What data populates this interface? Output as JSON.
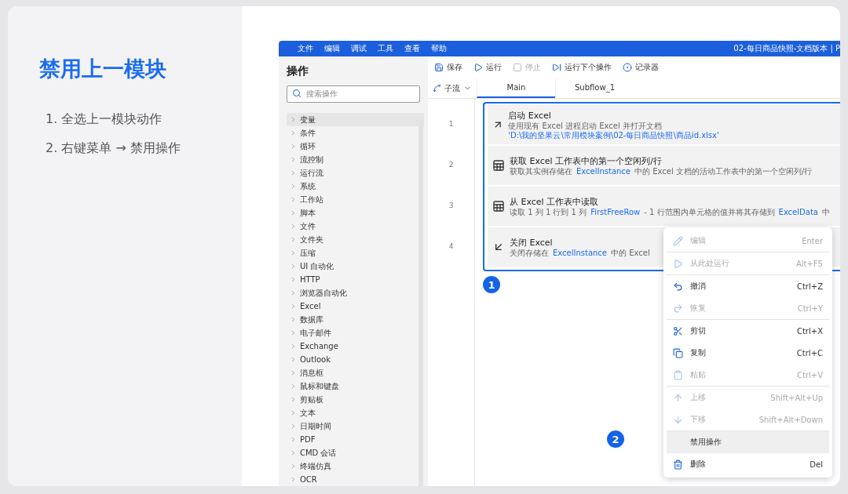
{
  "slide": {
    "title": "禁用上一模块",
    "steps": [
      "1. 全选上一模块动作",
      "2. 右键菜单 → 禁用操作"
    ]
  },
  "app": {
    "menu": [
      "文件",
      "编辑",
      "调试",
      "工具",
      "查看",
      "帮助"
    ],
    "title": "02-每日商品快照-文档版本 | P",
    "sidebar": {
      "heading": "操作",
      "search": {
        "placeholder": "搜索操作"
      },
      "items": [
        {
          "label": "变量",
          "selected": true
        },
        {
          "label": "条件",
          "selected": false
        },
        {
          "label": "循环",
          "selected": false
        },
        {
          "label": "流控制",
          "selected": false
        },
        {
          "label": "运行流",
          "selected": false
        },
        {
          "label": "系统",
          "selected": false
        },
        {
          "label": "工作站",
          "selected": false
        },
        {
          "label": "脚本",
          "selected": false
        },
        {
          "label": "文件",
          "selected": false
        },
        {
          "label": "文件夹",
          "selected": false
        },
        {
          "label": "压缩",
          "selected": false
        },
        {
          "label": "UI 自动化",
          "selected": false
        },
        {
          "label": "HTTP",
          "selected": false
        },
        {
          "label": "浏览器自动化",
          "selected": false
        },
        {
          "label": "Excel",
          "selected": false
        },
        {
          "label": "数据库",
          "selected": false
        },
        {
          "label": "电子邮件",
          "selected": false
        },
        {
          "label": "Exchange",
          "selected": false
        },
        {
          "label": "Outlook",
          "selected": false
        },
        {
          "label": "消息框",
          "selected": false
        },
        {
          "label": "鼠标和键盘",
          "selected": false
        },
        {
          "label": "剪贴板",
          "selected": false
        },
        {
          "label": "文本",
          "selected": false
        },
        {
          "label": "日期时间",
          "selected": false
        },
        {
          "label": "PDF",
          "selected": false
        },
        {
          "label": "CMD 会话",
          "selected": false
        },
        {
          "label": "终端仿真",
          "selected": false
        },
        {
          "label": "OCR",
          "selected": false
        }
      ]
    },
    "toolbar": [
      {
        "kind": "save",
        "label": "保存",
        "disabled": false
      },
      {
        "kind": "run",
        "label": "运行",
        "disabled": false
      },
      {
        "kind": "stop",
        "label": "停止",
        "disabled": true
      },
      {
        "kind": "step",
        "label": "运行下个操作",
        "disabled": false
      },
      {
        "kind": "record",
        "label": "记录器",
        "disabled": false
      }
    ],
    "subflow": {
      "label": "子流"
    },
    "tabs": [
      {
        "label": "Main",
        "selected": true
      },
      {
        "label": "Subflow_1",
        "selected": false
      }
    ],
    "actions": [
      {
        "number": "1",
        "kind": "launch",
        "title": "启动 Excel",
        "description": [
          {
            "kind": "text",
            "text": "使用现有 Excel 进程启动 Excel 并打开文档"
          },
          {
            "kind": "path",
            "text": "'D:\\我的坚果云\\常用模块案例\\02-每日商品快照\\商品id.xlsx'"
          }
        ]
      },
      {
        "number": "2",
        "kind": "excel",
        "title": "获取 Excel 工作表中的第一个空闲列/行",
        "description": [
          {
            "kind": "text",
            "text": "获取其实例存储在"
          },
          {
            "kind": "variable",
            "text": "ExcelInstance"
          },
          {
            "kind": "text",
            "text": "中的 Excel 文档的活动工作表中的第一个空闲列/行"
          }
        ]
      },
      {
        "number": "3",
        "kind": "excel",
        "title": "从 Excel 工作表中读取",
        "description": [
          {
            "kind": "text",
            "text": "读取 1 列 1 行到 1 列"
          },
          {
            "kind": "variable",
            "text": "FirstFreeRow"
          },
          {
            "kind": "text",
            "text": "- 1 行范围内单元格的值并将其存储到"
          },
          {
            "kind": "variable",
            "text": "ExcelData"
          },
          {
            "kind": "text",
            "text": "中"
          }
        ]
      },
      {
        "number": "4",
        "kind": "close",
        "title": "关闭 Excel",
        "description": [
          {
            "kind": "text",
            "text": "关闭存储在"
          },
          {
            "kind": "variable",
            "text": "ExcelInstance"
          },
          {
            "kind": "text",
            "text": "中的 Excel"
          }
        ]
      }
    ],
    "badges": [
      "1",
      "2"
    ],
    "context_menu": [
      [
        {
          "kind": "edit",
          "label": "编辑",
          "shortcut": "Enter",
          "disabled": true,
          "selected": false
        }
      ],
      [
        {
          "kind": "run",
          "label": "从此处运行",
          "shortcut": "Alt+F5",
          "disabled": true,
          "selected": false
        }
      ],
      [
        {
          "kind": "undo",
          "label": "撤消",
          "shortcut": "Ctrl+Z",
          "disabled": false,
          "selected": false
        },
        {
          "kind": "redo",
          "label": "恢复",
          "shortcut": "Ctrl+Y",
          "disabled": true,
          "selected": false
        }
      ],
      [
        {
          "kind": "cut",
          "label": "剪切",
          "shortcut": "Ctrl+X",
          "disabled": false,
          "selected": false
        },
        {
          "kind": "copy",
          "label": "复制",
          "shortcut": "Ctrl+C",
          "disabled": false,
          "selected": false
        },
        {
          "kind": "paste",
          "label": "粘贴",
          "shortcut": "Ctrl+V",
          "disabled": true,
          "selected": false
        }
      ],
      [
        {
          "kind": "up",
          "label": "上移",
          "shortcut": "Shift+Alt+Up",
          "disabled": true,
          "selected": false
        },
        {
          "kind": "down",
          "label": "下移",
          "shortcut": "Shift+Alt+Down",
          "disabled": true,
          "selected": false
        }
      ],
      [
        {
          "kind": "disable",
          "label": "禁用操作",
          "disabled": false,
          "selected": true
        },
        {
          "kind": "delete",
          "label": "删除",
          "shortcut": "Del",
          "disabled": false,
          "selected": false
        }
      ]
    ]
  }
}
